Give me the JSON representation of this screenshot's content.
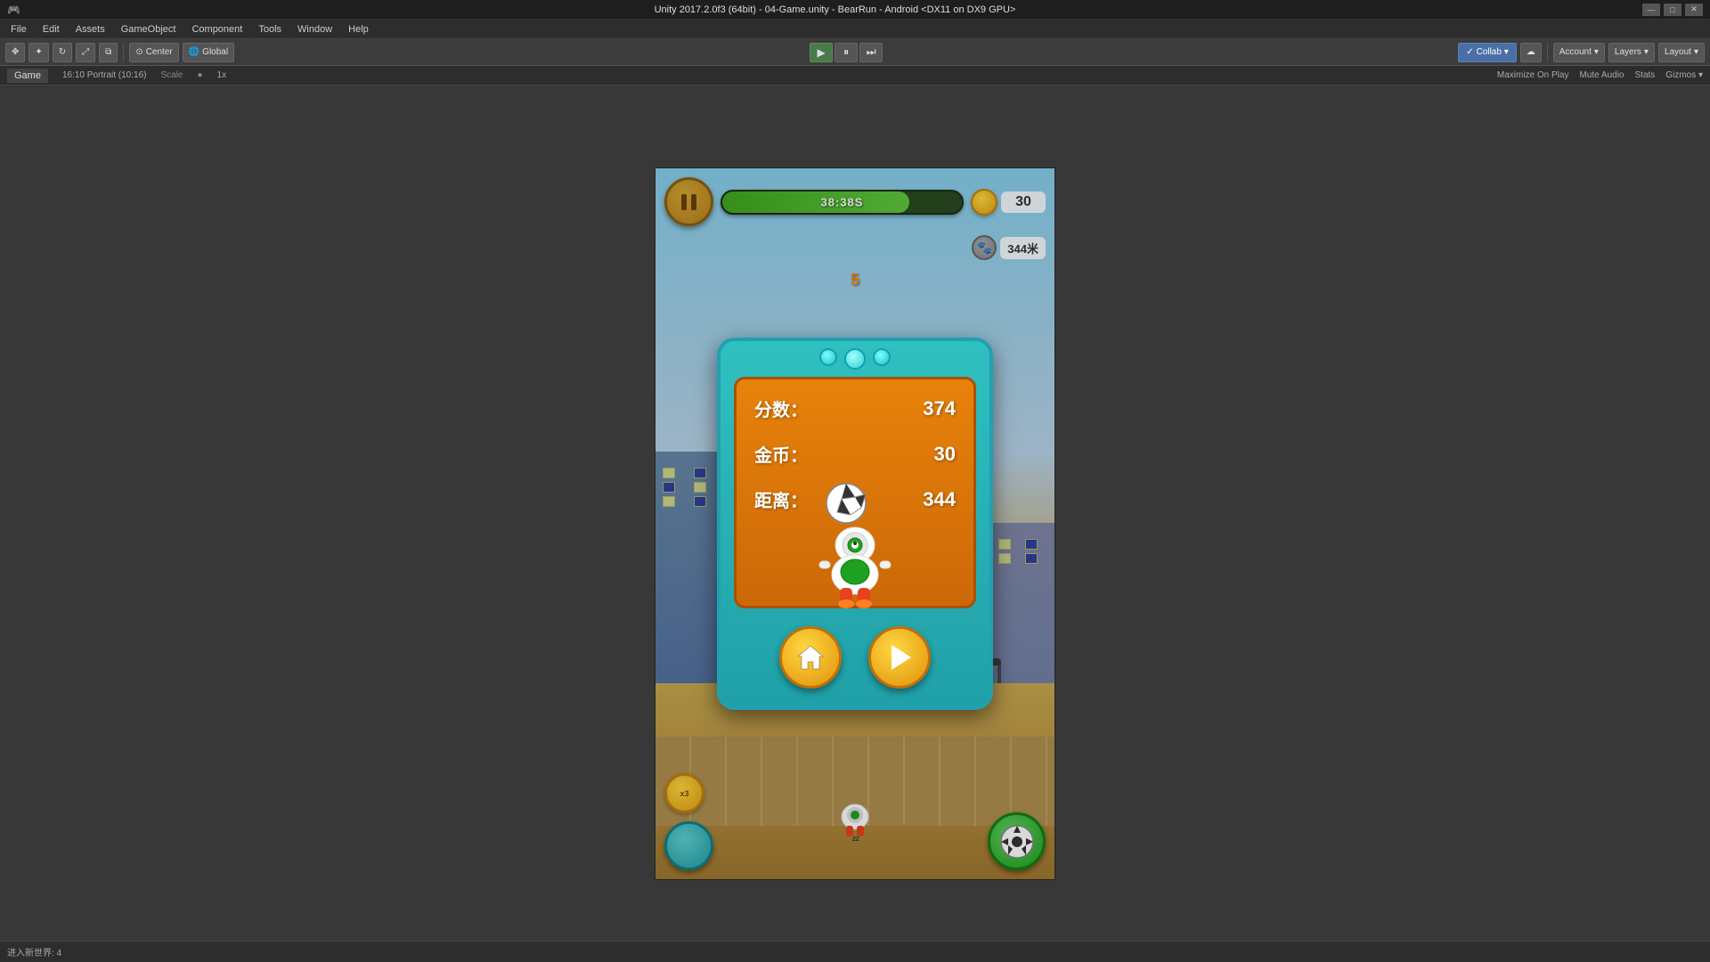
{
  "title_bar": {
    "text": "Unity 2017.2.0f3 (64bit) - 04-Game.unity - BearRun - Android <DX11 on DX9 GPU>"
  },
  "window_controls": {
    "minimize": "—",
    "maximize": "□",
    "close": "✕"
  },
  "menu": {
    "items": [
      "File",
      "Edit",
      "Assets",
      "GameObject",
      "Component",
      "Tools",
      "Window",
      "Help"
    ]
  },
  "toolbar": {
    "transform_tools": [
      "⊹",
      "✥",
      "⟲",
      "⤢",
      "⧉"
    ],
    "center_label": "Center",
    "global_label": "Global",
    "play_tooltip": "Play",
    "pause_tooltip": "Pause",
    "step_tooltip": "Step",
    "collab_label": "Collab ▾",
    "cloud_icon": "☁",
    "account_label": "Account",
    "layers_label": "Layers",
    "layout_label": "Layout"
  },
  "sub_toolbar": {
    "tab_label": "Game",
    "resolution": "16:10 Portrait (10:16)",
    "scale_label": "Scale",
    "scale_value": "1x",
    "right_items": [
      "Maximize On Play",
      "Mute Audio",
      "Stats",
      "Gizmos"
    ]
  },
  "hud": {
    "timer": "38:38S",
    "timer_fill_pct": 78,
    "coins": "30",
    "distance": "344米",
    "number_indicator": "5",
    "pause_label": "II"
  },
  "modal": {
    "score_label": "分数：",
    "score_value": "374",
    "coins_label": "金币：",
    "coins_value": "30",
    "distance_label": "距离：",
    "distance_value": "344",
    "home_btn_label": "Home",
    "play_btn_label": "Play"
  },
  "bottom_hud": {
    "coin_multiplier": "x3",
    "soccer_icon": "⚽"
  },
  "status_bar": {
    "text": "进入新世界: 4"
  },
  "colors": {
    "teal": "#20a0a8",
    "orange": "#e8820a",
    "gold": "#ffd840",
    "green_bar": "#60c840",
    "sky": "#87CEEB"
  }
}
